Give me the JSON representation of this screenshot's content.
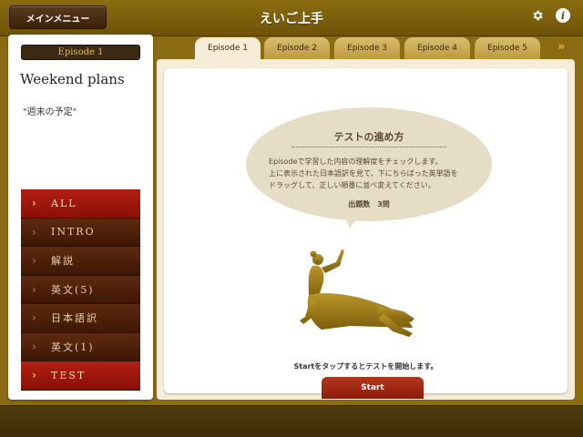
{
  "header": {
    "menu_label": "メインメニュー",
    "title": "えいご上手",
    "settings_icon": "gear-icon",
    "info_icon": "info-icon",
    "info_glyph": "i"
  },
  "lesson": {
    "episode_label": "Episode 1",
    "title": "Weekend plans",
    "subtitle": "\"週末の予定\""
  },
  "side_menu": {
    "items": [
      {
        "label": "ALL",
        "active": true
      },
      {
        "label": "INTRO",
        "active": false
      },
      {
        "label": "解説",
        "active": false
      },
      {
        "label": "英文(5)",
        "active": false
      },
      {
        "label": "日本語訳",
        "active": false
      },
      {
        "label": "英文(1)",
        "active": false
      },
      {
        "label": "TEST",
        "active": true
      }
    ]
  },
  "tabs": {
    "items": [
      {
        "label": "Episode 1",
        "active": true
      },
      {
        "label": "Episode 2",
        "active": false
      },
      {
        "label": "Episode 3",
        "active": false
      },
      {
        "label": "Episode 4",
        "active": false
      },
      {
        "label": "Episode 5",
        "active": false
      }
    ],
    "more_glyph": "»"
  },
  "test_panel": {
    "bubble_title": "テストの進め方",
    "bubble_lines": [
      "Episodeで学習した内容の理解度をチェックします。",
      "上に表示された日本語訳を見て、下にちらばった英単語を",
      "ドラッグして、正しい順番に並べ変えてください。"
    ],
    "question_count": "出題数　3問",
    "start_caption": "Startをタップするとテストを開始します。",
    "start_label": "Start"
  },
  "colors": {
    "frame": "#8a6a12",
    "accent_red": "#b31e12",
    "menu_dark": "#4a1f08",
    "gold_text": "#e9b84e",
    "figure_gold": "#9c7a14"
  }
}
